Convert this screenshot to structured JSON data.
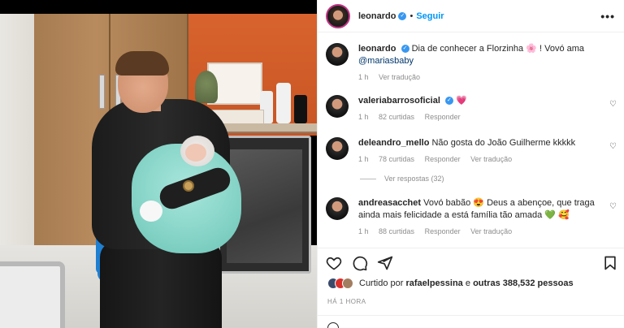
{
  "post": {
    "author": "leonardo",
    "follow_label": "Seguir",
    "separator": "•",
    "more_label": "•••",
    "verified_glyph": "✓"
  },
  "caption": {
    "username": "leonardo",
    "text": "Dia de conhecer a Florzinha",
    "emoji": "🌸",
    "text2": "! Vovó ama",
    "mention": "@mariasbaby",
    "time": "1 h",
    "translate": "Ver tradução"
  },
  "comments": [
    {
      "username": "valeriabarrosoficial",
      "verified": true,
      "text": "",
      "emoji": "💗",
      "time": "1 h",
      "likes": "82 curtidas",
      "reply": "Responder",
      "translate": ""
    },
    {
      "username": "deleandro_mello",
      "verified": false,
      "text": "Não gosta do João Guilherme kkkkk",
      "time": "1 h",
      "likes": "78 curtidas",
      "reply": "Responder",
      "translate": "Ver tradução",
      "view_replies": "Ver respostas (32)"
    },
    {
      "username": "andreasacchet",
      "verified": false,
      "text": "Vovó babão",
      "emoji1": "😍",
      "text2": "Deus a abençoe, que traga ainda mais felicidade a está família tão amada",
      "emoji2": "💚",
      "emoji3": "🥰",
      "time": "1 h",
      "likes": "88 curtidas",
      "reply": "Responder",
      "translate": "Ver tradução"
    }
  ],
  "actions": {
    "like_icon": "heart-icon",
    "comment_icon": "comment-icon",
    "share_icon": "share-icon",
    "save_icon": "bookmark-icon"
  },
  "likes": {
    "prefix": "Curtido por",
    "user": "rafaelpessina",
    "connector": "e",
    "others": "outras 388,532 pessoas"
  },
  "timestamp": "HÁ 1 HORA",
  "colors": {
    "link_blue": "#0095f6",
    "verified_blue": "#3897f0",
    "mention": "#00376b",
    "muted": "#8e8e8e",
    "text": "#262626"
  }
}
